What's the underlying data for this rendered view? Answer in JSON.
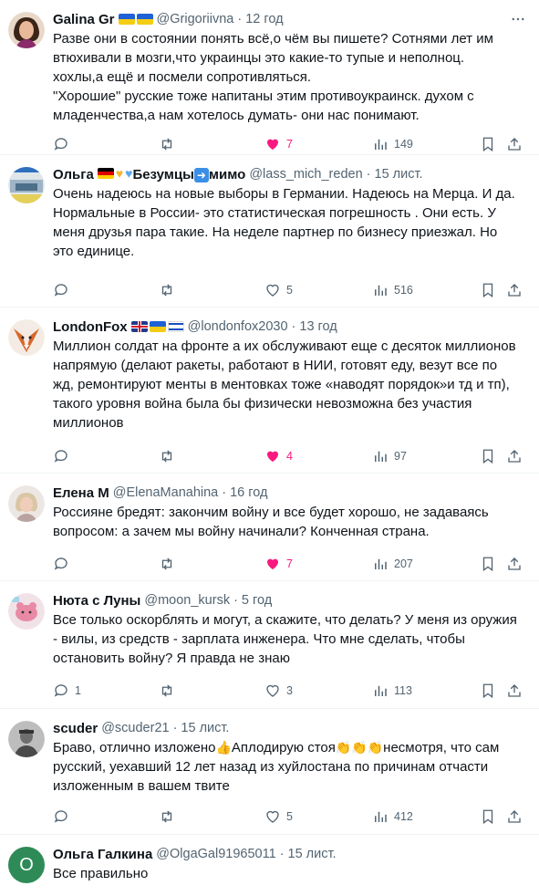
{
  "tweets": [
    {
      "name": "Galina Gr",
      "handle": "@Grigoriivna",
      "time": "12 год",
      "text": [
        "Разве они в состоянии понять всё,о чём вы пишете? Сотнями лет им втюхивали в мозги,что украинцы это какие-то тупые и неполноц. хохлы,а ещё и посмели сопротивляться.",
        "\"Хорошие\" русские тоже напитаны этим противоукраинск. духом с младенчества,а нам хотелось думать- они нас понимают."
      ],
      "replies": "",
      "reposts": "",
      "likes": "7",
      "views": "149"
    },
    {
      "name_a": "Ольга",
      "name_b": "Безумцы",
      "name_c": "мимо",
      "handle": "@lass_mich_reden",
      "time": "15 лист.",
      "text": [
        "Очень надеюсь на новые выборы в Германии. Надеюсь на Мерца. И да. Нормальные в России- это статистическая погрешность . Они есть. У меня друзья пара такие. На неделе партнер по бизнесу приезжал. Но это единице."
      ],
      "replies": "",
      "reposts": "",
      "likes": "5",
      "views": "516"
    },
    {
      "name": "LondonFox",
      "handle": "@londonfox2030",
      "time": "13 год",
      "text": [
        "Миллион солдат на фронте а их обслуживают еще с десяток миллионов напрямую (делают ракеты, работают в НИИ, готовят еду, везут все по жд, ремонтируют менты в ментовках тоже «наводят порядок»и тд и тп), такого уровня война была бы физически невозможна без участия миллионов"
      ],
      "replies": "",
      "reposts": "",
      "likes": "4",
      "views": "97"
    },
    {
      "name": "Елена М",
      "handle": "@ElenaManahina",
      "time": "16 год",
      "text": [
        "Россияне бредят: закончим войну и все будет хорошо, не задаваясь вопросом: а зачем мы войну начинали? Конченная страна."
      ],
      "replies": "",
      "reposts": "",
      "likes": "7",
      "views": "207"
    },
    {
      "name": "Нюта с Луны",
      "handle": "@moon_kursk",
      "time": "5 год",
      "text": [
        "Все только оскорблять и могут, а скажите, что делать? У меня из оружия - вилы, из средств - зарплата инженера. Что мне сделать, чтобы остановить войну? Я правда не знаю"
      ],
      "replies": "1",
      "reposts": "",
      "likes": "3",
      "views": "113"
    },
    {
      "name": "scuder",
      "handle": "@scuder21",
      "time": "15 лист.",
      "text_a": "Браво, отлично изложено",
      "text_b": "Аплодирую стоя",
      "text_c": "несмотря, что сам русский, уехавший 12 лет назад из хуйлостана по причинам отчасти изложенным в вашем твите",
      "replies": "",
      "reposts": "",
      "likes": "5",
      "views": "412"
    },
    {
      "name": "Ольга Галкина",
      "handle": "@OlgaGal91965011",
      "time": "15 лист.",
      "avatar_letter": "O",
      "text": [
        "Все правильно"
      ]
    }
  ],
  "dot": "·",
  "colors": {
    "like_active": "#f91880",
    "muted": "#536471",
    "border": "#eff3f4"
  }
}
